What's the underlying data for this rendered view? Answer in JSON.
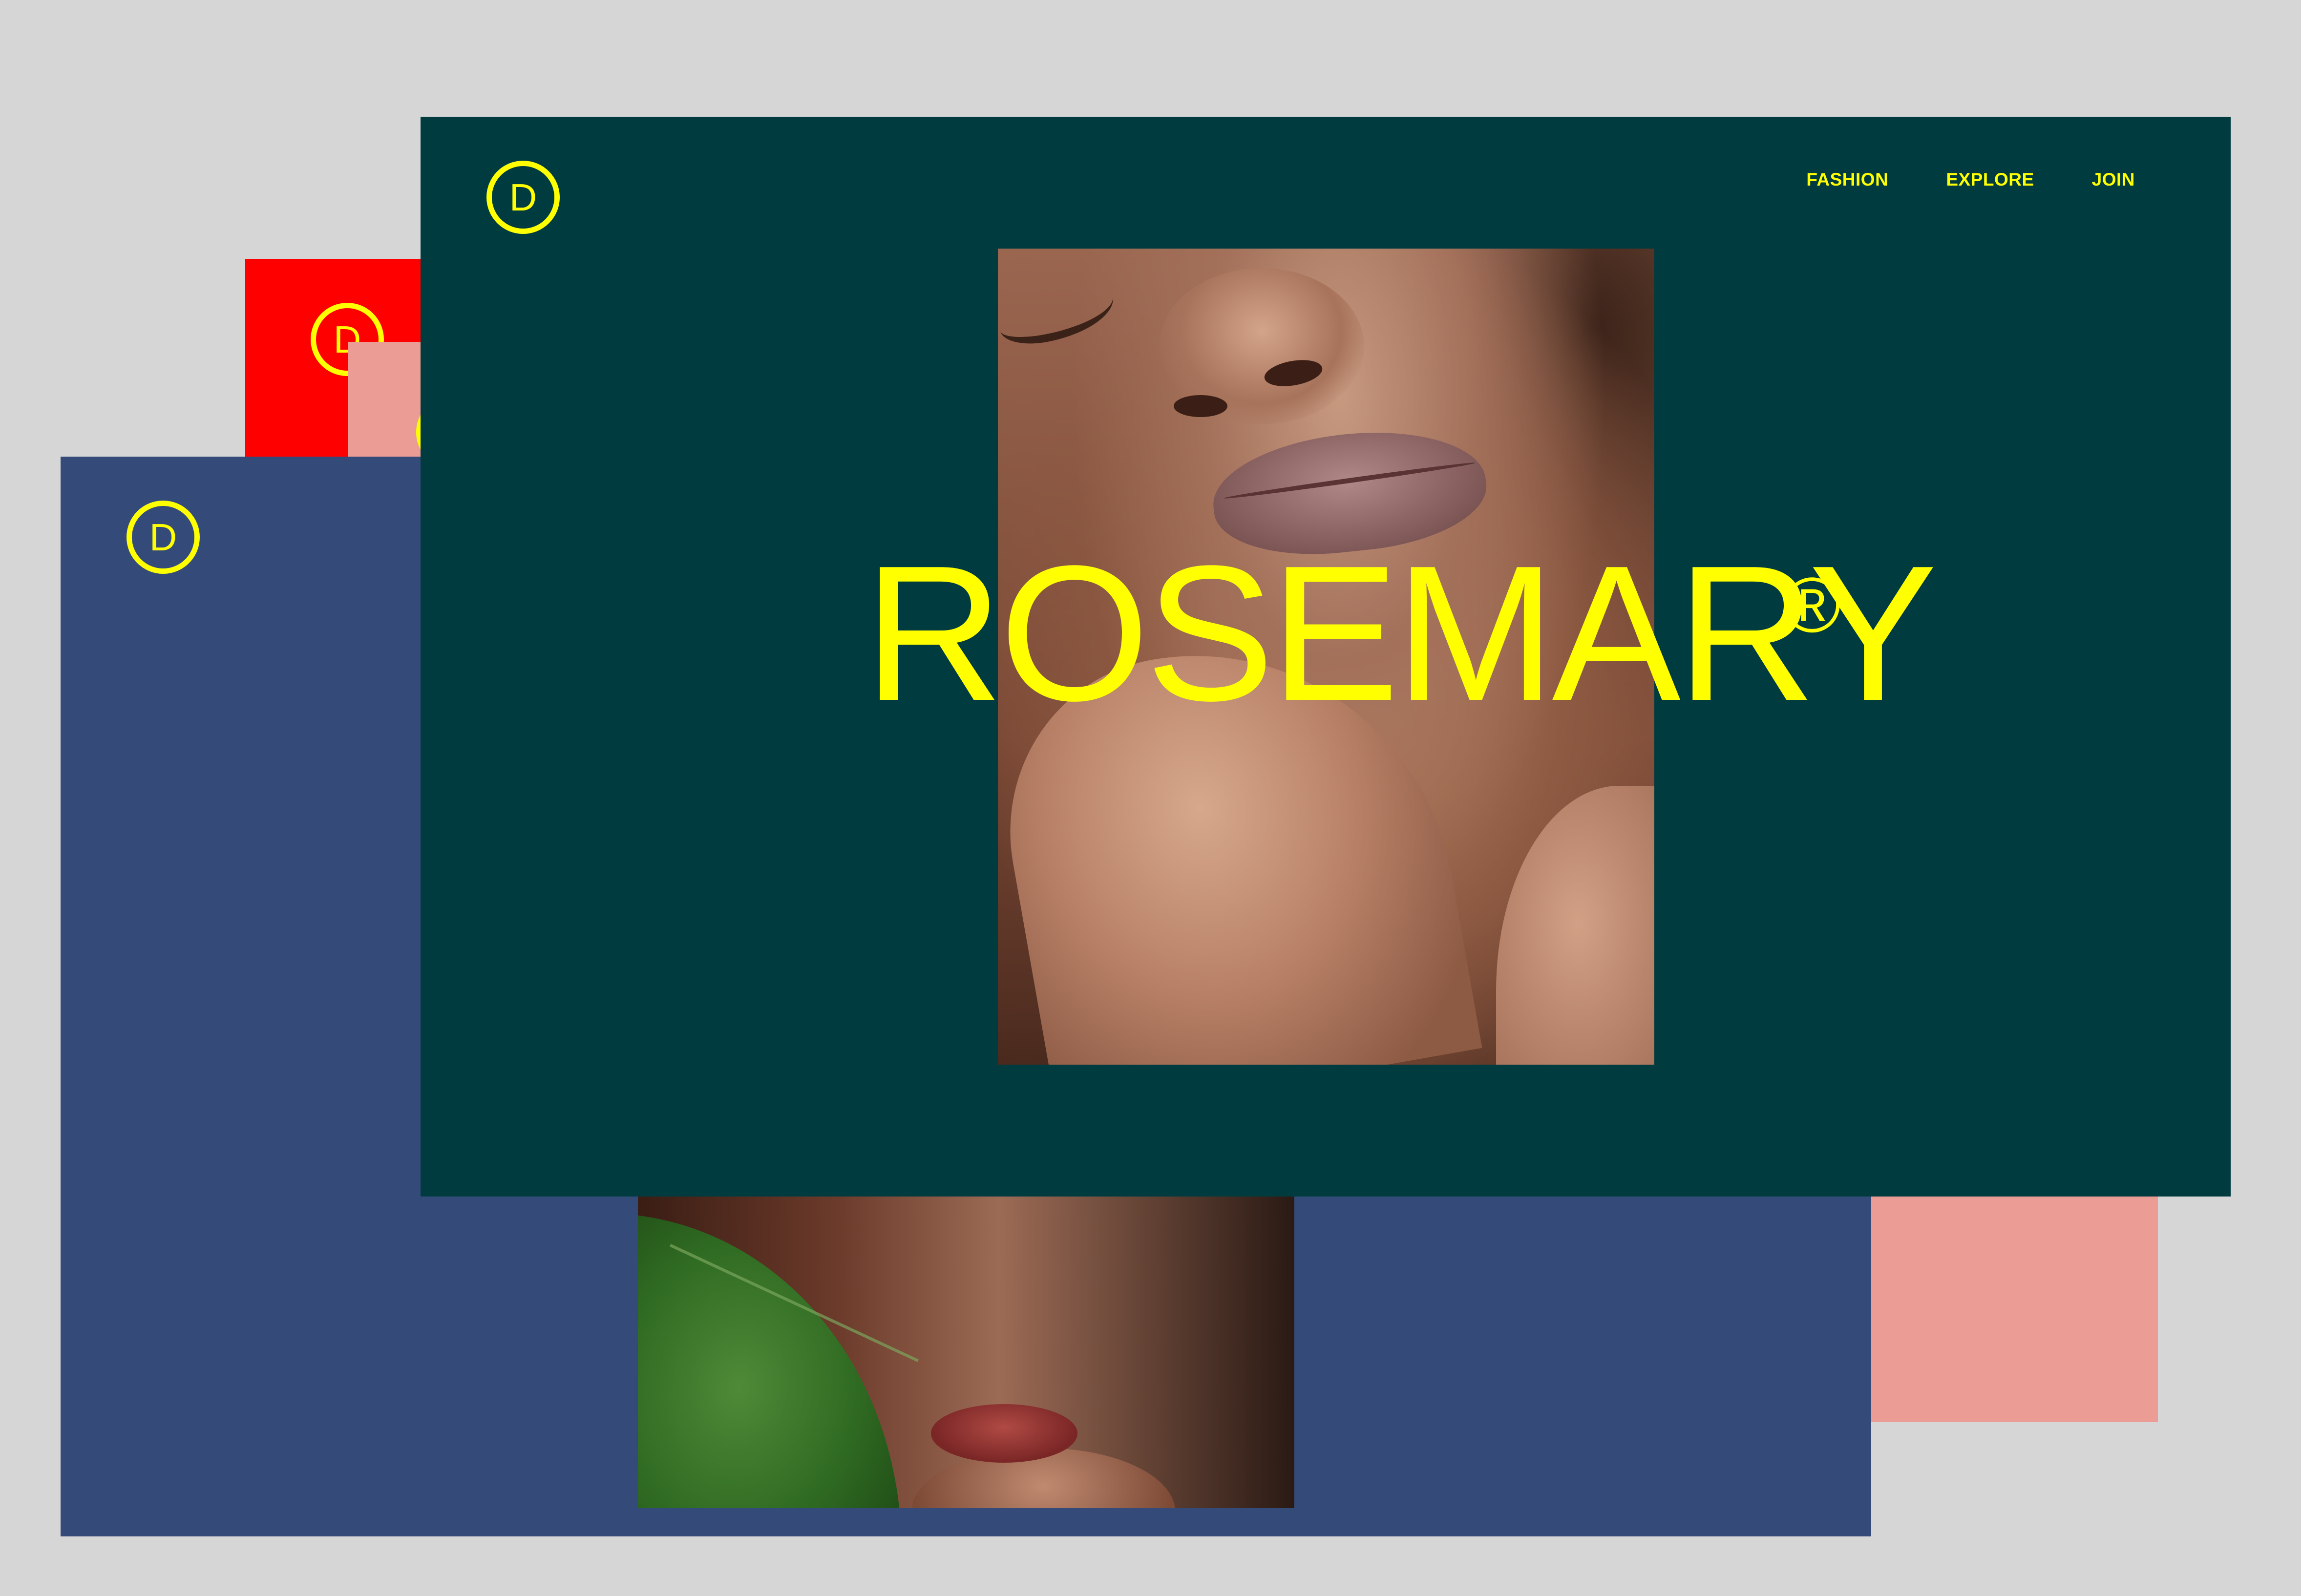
{
  "brand": {
    "logo_letter": "D",
    "title": "ROSEMARY",
    "registered_mark": "®"
  },
  "nav": {
    "items": [
      {
        "label": "FASHION"
      },
      {
        "label": "EXPLORE"
      },
      {
        "label": "JOIN"
      }
    ]
  },
  "colors": {
    "background": "#d6d6d6",
    "accent_yellow": "#ffff00",
    "front_card": "#003b40",
    "blue_card": "#344b7a",
    "pink_card": "#eb9c94",
    "red_card": "#ff0000"
  },
  "icons": {
    "logo": "circled-d-logo-icon"
  }
}
